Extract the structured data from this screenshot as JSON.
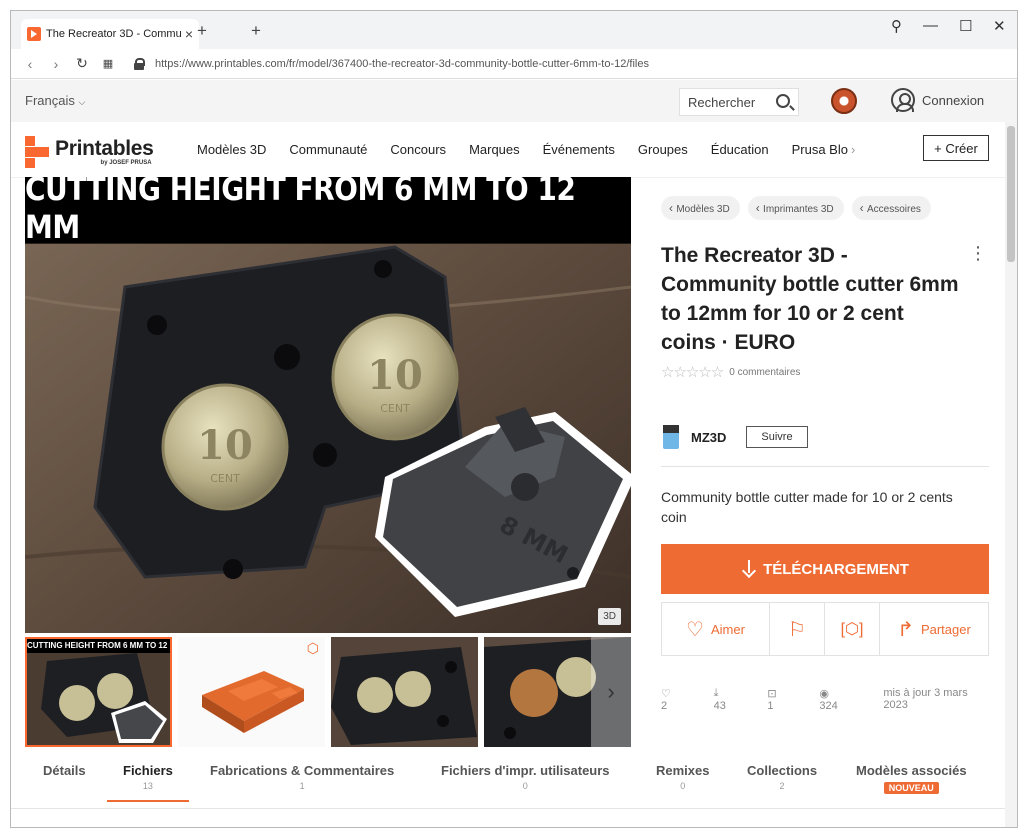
{
  "browser": {
    "tab_title": "The Recreator 3D - Commu",
    "tab_close": "×",
    "new_tab": "+",
    "url": "https://www.printables.com/fr/model/367400-the-recreator-3d-community-bottle-cutter-6mm-to-12/files"
  },
  "util": {
    "language": "Français",
    "search_label": "Rechercher",
    "login": "Connexion"
  },
  "nav": {
    "brand": "Printables",
    "brand_sub": "by JOSEF PRUSA",
    "links": [
      "Modèles 3D",
      "Communauté",
      "Concours",
      "Marques",
      "Événements",
      "Groupes",
      "Éducation",
      "Prusa Blo"
    ],
    "create": "+ Créer"
  },
  "hero": {
    "banner": "CUTTING HEIGHT FROM 6 MM TO 12 MM",
    "badge_3d": "3D",
    "thumb1_caption": "CUTTING HEIGHT FROM 6 MM TO 12 MM",
    "coin_text": "10",
    "coin_sub": "CENT",
    "part_text": "8 MM"
  },
  "model": {
    "breadcrumbs": [
      "Modèles 3D",
      "Imprimantes 3D",
      "Accessoires"
    ],
    "title": "The Recreator 3D - Community bottle cutter 6mm to 12mm for 10 or 2 cent coins · EURO",
    "stars": "☆☆☆☆☆",
    "comments": "0 commentaires",
    "author": "MZ3D",
    "follow": "Suivre",
    "description": "Community bottle cutter made for 10 or 2 cents coin",
    "download": "TÉLÉCHARGEMENT",
    "like": "Aimer",
    "share": "Partager"
  },
  "stats": {
    "likes": "2",
    "downloads": "43",
    "makes": "1",
    "views": "324",
    "updated": "mis à jour 3 mars 2023"
  },
  "tabs": [
    {
      "label": "Détails",
      "count": ""
    },
    {
      "label": "Fichiers",
      "count": "13"
    },
    {
      "label": "Fabrications & Commentaires",
      "count": "1"
    },
    {
      "label": "Fichiers d'impr. utilisateurs",
      "count": "0"
    },
    {
      "label": "Remixes",
      "count": "0"
    },
    {
      "label": "Collections",
      "count": "2"
    },
    {
      "label": "Modèles associés",
      "badge": "NOUVEAU"
    }
  ],
  "colors": {
    "accent": "#ee6b33",
    "brand": "#fa6831"
  }
}
